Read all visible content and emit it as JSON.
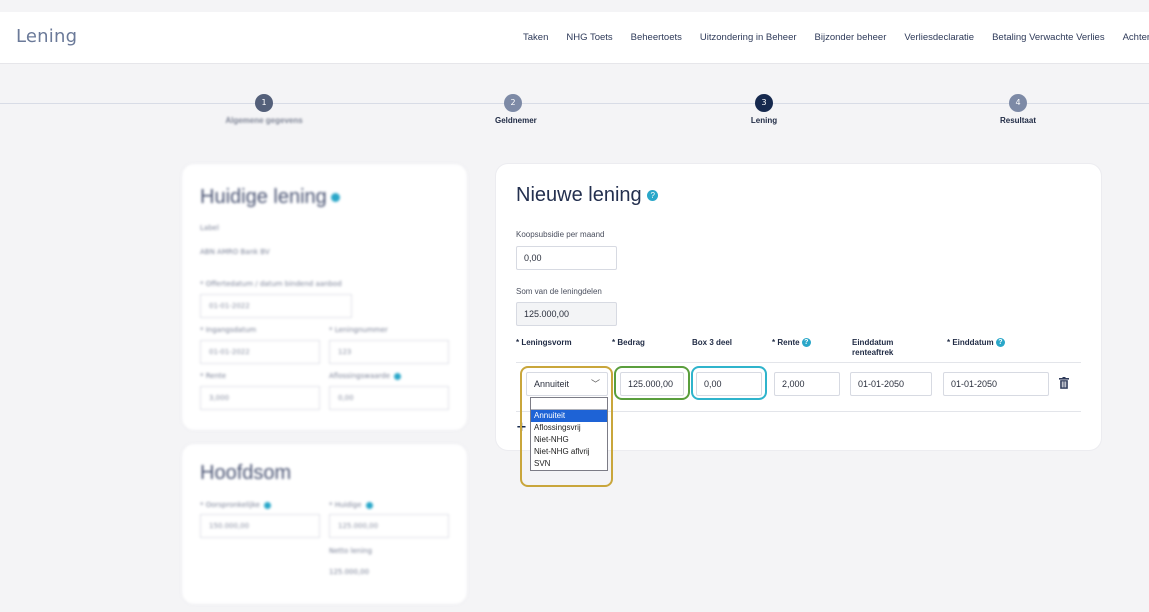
{
  "header": {
    "title": "Lening",
    "nav": [
      "Taken",
      "NHG Toets",
      "Beheertoets",
      "Uitzondering in Beheer",
      "Bijzonder beheer",
      "Verliesdeclaratie",
      "Betaling Verwachte Verlies",
      "Achterstand"
    ]
  },
  "steps": [
    {
      "num": "1",
      "label": "Algemene gegevens"
    },
    {
      "num": "2",
      "label": "Geldnemer"
    },
    {
      "num": "3",
      "label": "Lening"
    },
    {
      "num": "4",
      "label": "Resultaat"
    }
  ],
  "current_loan": {
    "title": "Huidige lening",
    "label_caption": "Label",
    "label_value": "ABN AMRO Bank BV",
    "offer_caption": "* Offertedatum / datum bindend aanbod",
    "offer_value": "01-01-2022",
    "start_caption": "* Ingangsdatum",
    "start_value": "01-01-2022",
    "number_caption": "* Leningnummer",
    "number_value": "123",
    "rate_caption": "* Rente",
    "rate_value": "3,000",
    "repay_caption": "Aflossingswaarde",
    "repay_value": "0,00"
  },
  "principal": {
    "title": "Hoofdsom",
    "original_caption": "* Oorspronkelijke",
    "original_value": "150.000,00",
    "current_caption": "* Huidige",
    "current_value": "125.000,00",
    "net_caption": "Netto lening",
    "net_value": "125.000,00"
  },
  "new_loan": {
    "title": "Nieuwe lening",
    "subsidy_label": "Koopsubsidie per maand",
    "subsidy_value": "0,00",
    "sum_label": "Som van de leningdelen",
    "sum_value": "125.000,00",
    "columns": {
      "form": "* Leningsvorm",
      "amount": "* Bedrag",
      "box3": "Box 3 deel",
      "rate": "* Rente",
      "end_deduction_1": "Einddatum",
      "end_deduction_2": "renteaftrek",
      "end_date": "* Einddatum"
    },
    "row": {
      "form": "Annuiteit",
      "amount": "125.000,00",
      "box3": "0,00",
      "rate": "2,000",
      "end_deduction": "01-01-2050",
      "end_date": "01-01-2050"
    },
    "dropdown_options": [
      "Annuiteit",
      "Aflossingsvrij",
      "Niet-NHG",
      "Niet-NHG aflvrij",
      "SVN"
    ],
    "selected_option_index": 0
  },
  "colors": {
    "highlight_yellow": "#c9a63b",
    "highlight_green": "#5a9e3d",
    "highlight_cyan": "#2fb4cc",
    "accent": "#2aa7c9",
    "active_step": "#16294e"
  }
}
